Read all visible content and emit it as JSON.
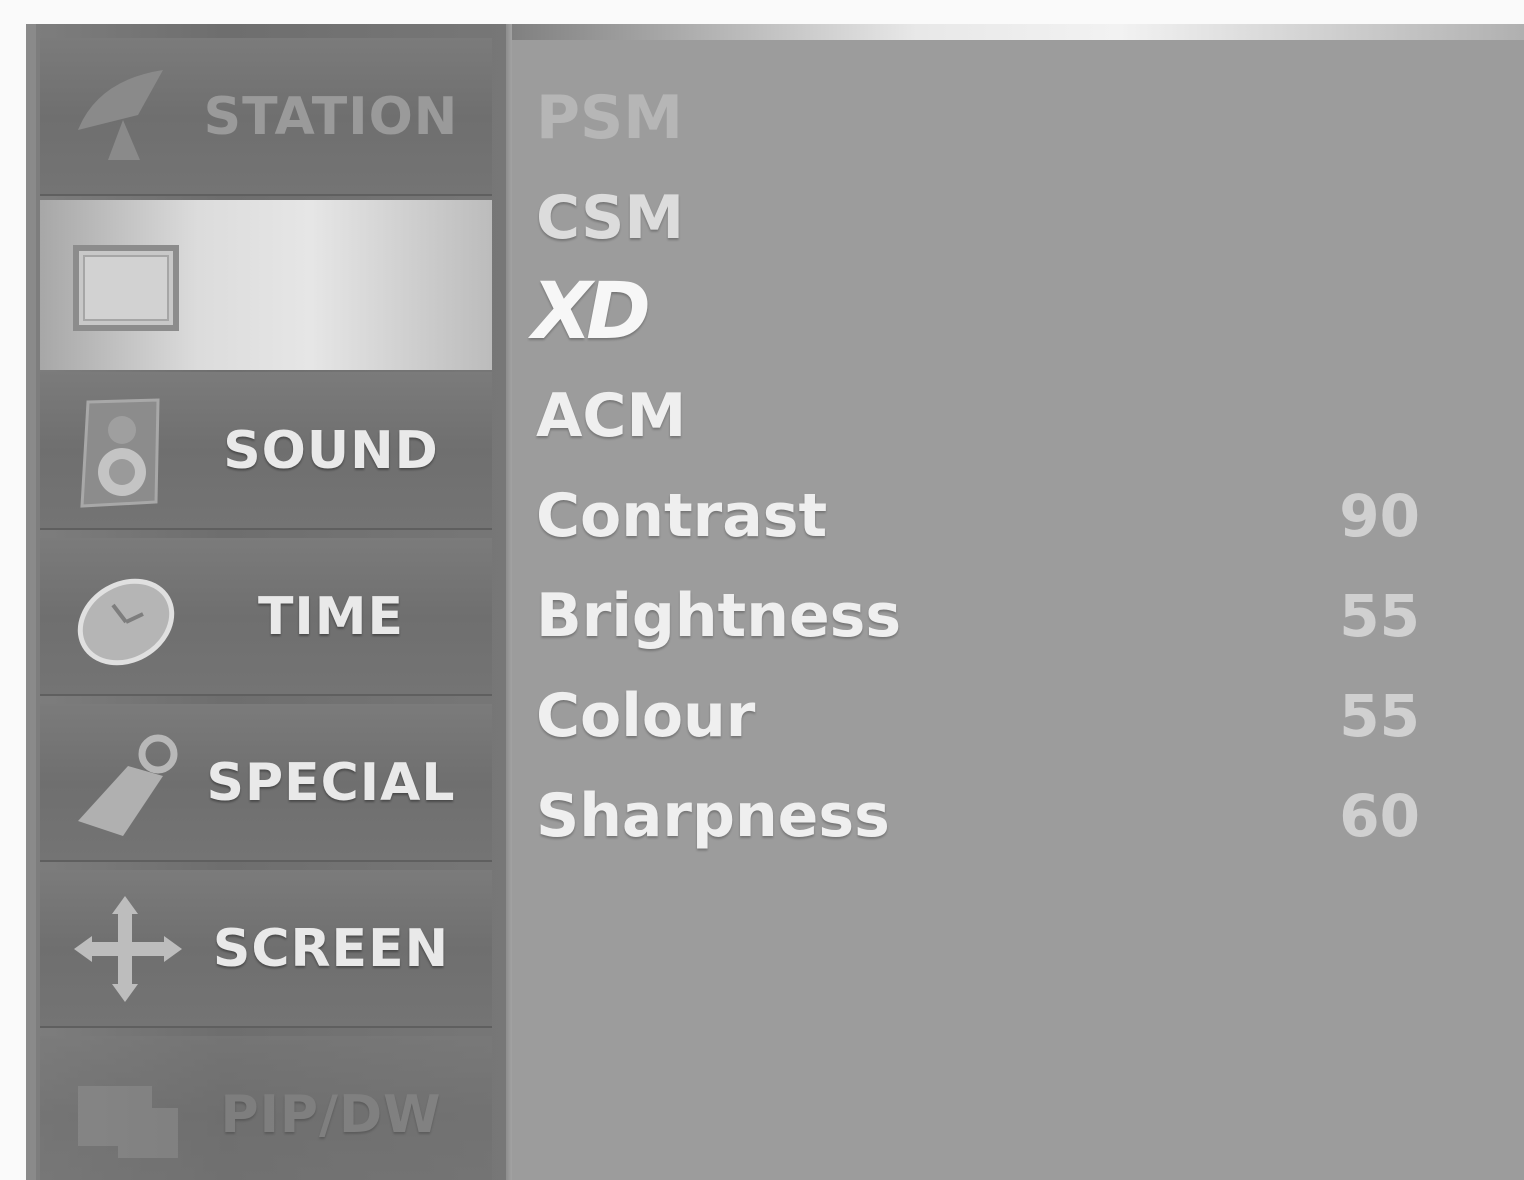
{
  "sidebar": {
    "items": [
      {
        "label": "STATION",
        "icon": "satellite-dish-icon",
        "state": "dim"
      },
      {
        "label": "",
        "icon": "picture-frame-icon",
        "state": "active"
      },
      {
        "label": "SOUND",
        "icon": "speaker-icon",
        "state": "normal"
      },
      {
        "label": "TIME",
        "icon": "clock-icon",
        "state": "normal"
      },
      {
        "label": "SPECIAL",
        "icon": "tag-icon",
        "state": "normal"
      },
      {
        "label": "SCREEN",
        "icon": "move-arrows-icon",
        "state": "normal"
      },
      {
        "label": "PIP/DW",
        "icon": "pip-window-icon",
        "state": "faded"
      }
    ]
  },
  "picture_menu": {
    "items": [
      {
        "label": "PSM",
        "value": ""
      },
      {
        "label": "CSM",
        "value": ""
      },
      {
        "label": "XD",
        "value": ""
      },
      {
        "label": "ACM",
        "value": ""
      },
      {
        "label": "Contrast",
        "value": "90"
      },
      {
        "label": "Brightness",
        "value": "55"
      },
      {
        "label": "Colour",
        "value": "55"
      },
      {
        "label": "Sharpness",
        "value": "60"
      }
    ]
  },
  "colors": {
    "panel_bg": "#9c9c9c",
    "sidebar_bg": "#6c6c6c",
    "active_tab": "#dcdcdc",
    "text": "#efefef"
  }
}
